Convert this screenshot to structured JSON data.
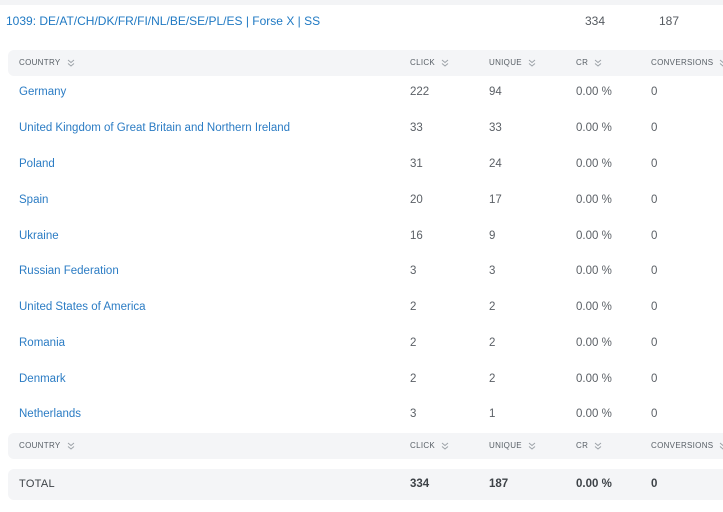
{
  "campaign": {
    "title": "1039: DE/AT/CH/DK/FR/FI/NL/BE/SE/PL/ES | Forse X | SS",
    "click": "334",
    "unique": "187"
  },
  "columns": {
    "country": "COUNTRY",
    "click": "CLICK",
    "unique": "UNIQUE",
    "cr": "CR",
    "conversions": "CONVERSIONS"
  },
  "rows": [
    {
      "country": "Germany",
      "click": "222",
      "unique": "94",
      "cr": "0.00 %",
      "conversions": "0"
    },
    {
      "country": "United Kingdom of Great Britain and Northern Ireland",
      "click": "33",
      "unique": "33",
      "cr": "0.00 %",
      "conversions": "0"
    },
    {
      "country": "Poland",
      "click": "31",
      "unique": "24",
      "cr": "0.00 %",
      "conversions": "0"
    },
    {
      "country": "Spain",
      "click": "20",
      "unique": "17",
      "cr": "0.00 %",
      "conversions": "0"
    },
    {
      "country": "Ukraine",
      "click": "16",
      "unique": "9",
      "cr": "0.00 %",
      "conversions": "0"
    },
    {
      "country": "Russian Federation",
      "click": "3",
      "unique": "3",
      "cr": "0.00 %",
      "conversions": "0"
    },
    {
      "country": "United States of America",
      "click": "2",
      "unique": "2",
      "cr": "0.00 %",
      "conversions": "0"
    },
    {
      "country": "Romania",
      "click": "2",
      "unique": "2",
      "cr": "0.00 %",
      "conversions": "0"
    },
    {
      "country": "Denmark",
      "click": "2",
      "unique": "2",
      "cr": "0.00 %",
      "conversions": "0"
    },
    {
      "country": "Netherlands",
      "click": "3",
      "unique": "1",
      "cr": "0.00 %",
      "conversions": "0"
    }
  ],
  "total": {
    "label": "TOTAL",
    "click": "334",
    "unique": "187",
    "cr": "0.00 %",
    "conversions": "0"
  },
  "icons": {
    "sort": "chevron-double-down-icon"
  },
  "colors": {
    "link": "#2b7cc4",
    "header_bg": "#f4f5f7",
    "text": "#5b6066"
  }
}
